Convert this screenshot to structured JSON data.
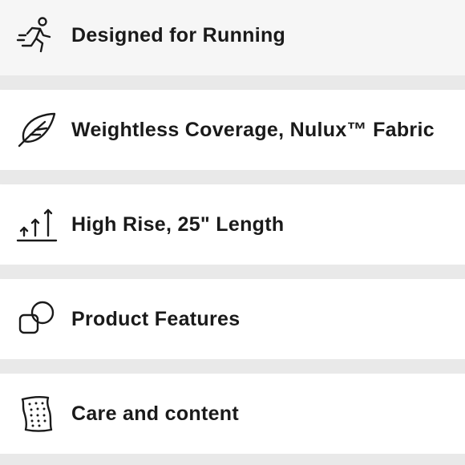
{
  "features": {
    "items": [
      {
        "label": "Designed for Running",
        "icon": "running-person-icon"
      },
      {
        "label": "Weightless Coverage, Nulux™ Fabric",
        "icon": "feather-icon"
      },
      {
        "label": "High Rise, 25\" Length",
        "icon": "rise-arrows-icon"
      },
      {
        "label": "Product Features",
        "icon": "overlapping-shapes-icon"
      },
      {
        "label": "Care and content",
        "icon": "fabric-swatch-icon"
      }
    ]
  }
}
